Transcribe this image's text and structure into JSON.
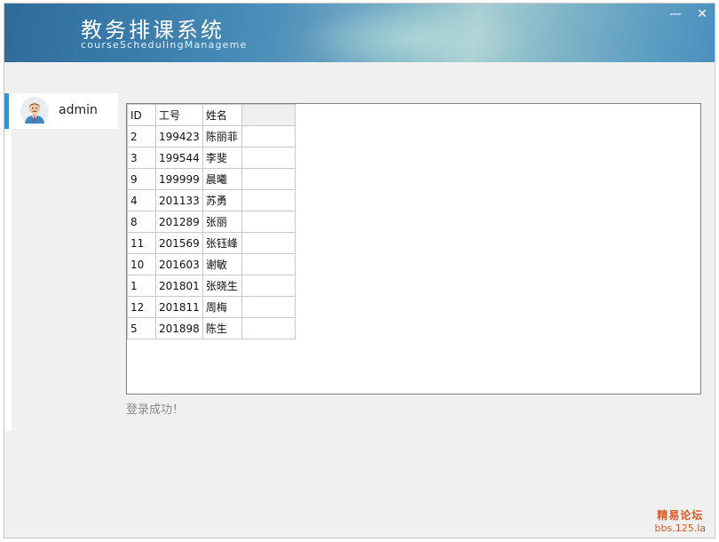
{
  "app": {
    "title": "教务排课系统",
    "subtitle": "courseSchedulingManageme"
  },
  "window_controls": {
    "minimize": "—",
    "close": "✕"
  },
  "user": {
    "name": "admin"
  },
  "table": {
    "columns": [
      "ID",
      "工号",
      "姓名",
      ""
    ],
    "rows": [
      [
        "2",
        "199423",
        "陈丽菲",
        ""
      ],
      [
        "3",
        "199544",
        "李斐",
        ""
      ],
      [
        "9",
        "199999",
        "晨曦",
        ""
      ],
      [
        "4",
        "201133",
        "苏勇",
        ""
      ],
      [
        "8",
        "201289",
        "张丽",
        ""
      ],
      [
        "11",
        "201569",
        "张钰峰",
        ""
      ],
      [
        "10",
        "201603",
        "谢敏",
        ""
      ],
      [
        "1",
        "201801",
        "张晓生",
        ""
      ],
      [
        "12",
        "201811",
        "周梅",
        ""
      ],
      [
        "5",
        "201898",
        "陈生",
        ""
      ]
    ]
  },
  "status": {
    "message": "登录成功！"
  },
  "watermark": {
    "title": "精易论坛",
    "url": "bbs.125.la"
  },
  "colors": {
    "accent": "#1e9be0",
    "status_text": "#8a8a8a",
    "watermark": "#d9581e"
  }
}
